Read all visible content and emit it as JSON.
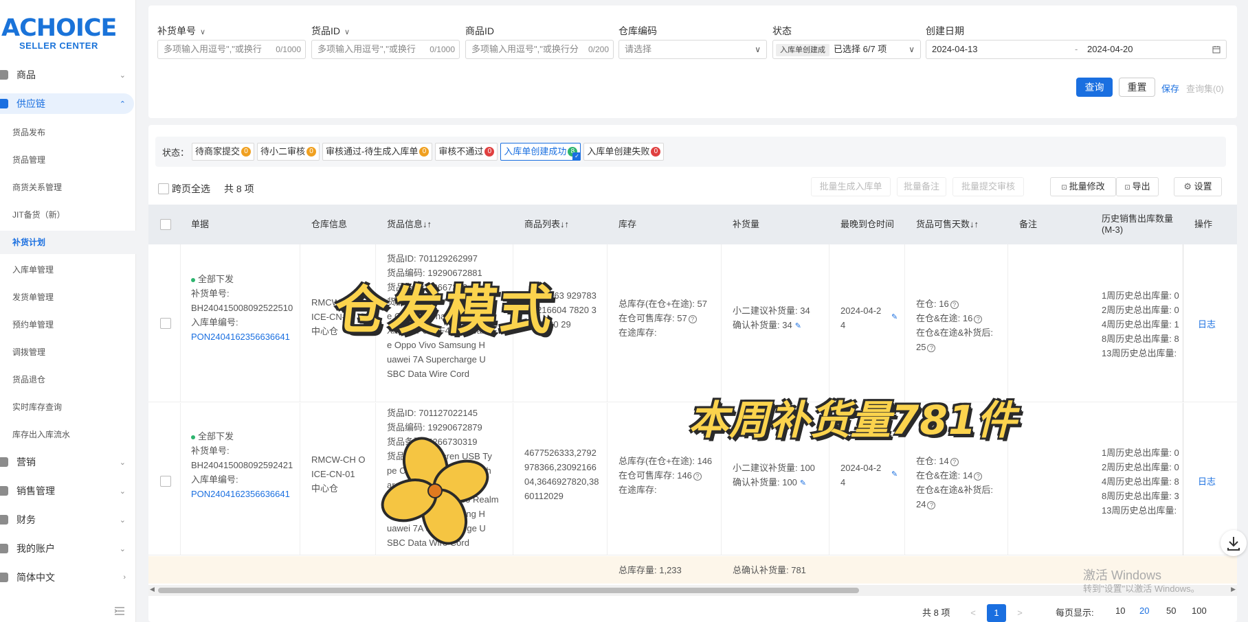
{
  "logo": {
    "brand": "ACHOICE",
    "sub": "SELLER CENTER"
  },
  "sidebar": {
    "top_items": [
      {
        "label": "商品"
      },
      {
        "label": "供应链"
      }
    ],
    "sub_items": [
      {
        "label": "货品发布"
      },
      {
        "label": "货品管理"
      },
      {
        "label": "商货关系管理"
      },
      {
        "label": "JIT备货（新）"
      },
      {
        "label": "补货计划"
      },
      {
        "label": "入库单管理"
      },
      {
        "label": "发货单管理"
      },
      {
        "label": "预约单管理"
      },
      {
        "label": "调拨管理"
      },
      {
        "label": "货品退仓"
      },
      {
        "label": "实时库存查询"
      },
      {
        "label": "库存出入库流水"
      }
    ],
    "bottom_items": [
      {
        "label": "营销"
      },
      {
        "label": "销售管理"
      },
      {
        "label": "财务"
      },
      {
        "label": "我的账户"
      },
      {
        "label": "简体中文"
      }
    ]
  },
  "filters": {
    "replenish_no": {
      "label": "补货单号",
      "placeholder": "多项输入用逗号\",\"或换行",
      "count": "0/1000"
    },
    "goods_id": {
      "label": "货品ID",
      "placeholder": "多项输入用逗号\",\"或换行",
      "count": "0/1000"
    },
    "product_id": {
      "label": "商品ID",
      "placeholder": "多项输入用逗号\",\"或换行分",
      "count": "0/200"
    },
    "warehouse_code": {
      "label": "仓库编码",
      "placeholder": "请选择"
    },
    "status": {
      "label": "状态",
      "chip": "入库单创建成",
      "summary": "已选择 6/7 项"
    },
    "create_date": {
      "label": "创建日期",
      "start": "2024-04-13",
      "sep": "-",
      "end": "2024-04-20"
    },
    "query_label": "查询",
    "reset_label": "重置",
    "save_label": "保存",
    "query_set_label": "查询集(0)"
  },
  "status_bar": {
    "label": "状态：",
    "items": [
      {
        "label": "待商家提交",
        "count": "0",
        "color": "#f0a020"
      },
      {
        "label": "待小二审核",
        "count": "0",
        "color": "#f0a020"
      },
      {
        "label": "审核通过-待生成入库单",
        "count": "0",
        "color": "#f0a020"
      },
      {
        "label": "审核不通过",
        "count": "0",
        "color": "#e04040"
      },
      {
        "label": "入库单创建成功",
        "count": "8",
        "color": "#2db46e"
      },
      {
        "label": "入库单创建失败",
        "count": "0",
        "color": "#e04040"
      }
    ]
  },
  "toolbar": {
    "select_all_label": "跨页全选",
    "total_label": "共 8 项",
    "batch_create_label": "批量生成入库单",
    "batch_note_label": "批量备注",
    "batch_submit_label": "批量提交审核",
    "batch_edit_label": "批量修改",
    "export_label": "导出",
    "settings_label": "设置"
  },
  "table": {
    "headers": [
      "单据",
      "仓库信息",
      "货品信息↓↑",
      "商品列表↓↑",
      "库存",
      "补货量",
      "最晚到仓时间",
      "货品可售天数↓↑",
      "备注",
      "历史销售出库数量(M-3)",
      "操作"
    ],
    "rows": [
      {
        "status": "全部下发",
        "replenish_no_label": "补货单号:",
        "replenish_no": "BH240415008092522510",
        "inbound_no_label": "入库单编号:",
        "inbound_no": "PON2404162356636641",
        "warehouse_code": "RMCW-CH OICE-CN-01",
        "warehouse_name": "中心仓",
        "goods_lines": [
          "货品ID: 701129262997",
          "货品编码: 19290672881",
          "货品条码: 52667303",
          "货品名称: 50W Fast",
          "e C Cable Charger Cable",
          "Xiaomi Poco F4 F3 Realm",
          "e Oppo Vivo Samsung H",
          "uawei 7A Supercharge U",
          "SBC Data Wire Cord"
        ],
        "product_list": "46775263 92978366 216604 7820 38601120 29",
        "stock_total": "总库存(在仓+在途): 57",
        "stock_sellable": "在仓可售库存: 57",
        "stock_transit": "在途库存:",
        "suggest": "小二建议补货量: 34",
        "confirm": "确认补货量: 34",
        "deadline": "2024-04-24",
        "days_in": "在仓: 16",
        "days_both": "在仓&在途: 16",
        "days_after": "在仓&在途&补货后: 25",
        "history": [
          "1周历史总出库量: 0",
          "2周历史总出库量: 0",
          "4周历史总出库量: 1",
          "8周历史总出库量: 8",
          "13周历史总出库量:"
        ],
        "action": "日志"
      },
      {
        "status": "全部下发",
        "replenish_no_label": "补货单号:",
        "replenish_no": "BH240415008092592421",
        "inbound_no_label": "入库单编号:",
        "inbound_no": "PON2404162356636641",
        "warehouse_code": "RMCW-CH OICE-CN-01",
        "warehouse_name": "中心仓",
        "goods_lines": [
          "货品ID: 701127022145",
          "货品编码: 19290672879",
          "货品条码: 5266730319",
          "货品名称: Toocren USB Ty",
          "pe C Cable 120W Fast Ch",
          "arger Cable For",
          "Xiaomi Realme Poco Realm",
          "e Oppo Vivo Samsung H",
          "uawei 7A Supercharge U",
          "SBC Data Wire Cord"
        ],
        "product_list": "4677526333,2792978366,2309216604,3646927820,3860112029",
        "stock_total": "总库存(在仓+在途): 146",
        "stock_sellable": "在仓可售库存: 146",
        "stock_transit": "在途库存:",
        "suggest": "小二建议补货量: 100",
        "confirm": "确认补货量: 100",
        "deadline": "2024-04-24",
        "days_in": "在仓: 14",
        "days_both": "在仓&在途: 14",
        "days_after": "在仓&在途&补货后: 24",
        "history": [
          "1周历史总出库量: 0",
          "2周历史总出库量: 0",
          "4周历史总出库量: 8",
          "8周历史总出库量: 3",
          "13周历史总出库量:"
        ],
        "action": "日志"
      }
    ],
    "summary_stock": "总库存量: 1,233",
    "summary_confirm": "总确认补货量: 781"
  },
  "pager": {
    "total": "共 8 项",
    "current": "1",
    "prev": "<",
    "next": ">",
    "page_size_label": "每页显示:",
    "sizes": [
      "10",
      "20",
      "50",
      "100"
    ]
  },
  "overlay": {
    "title": "仓发模式",
    "subtitle": "本周补货量781件"
  },
  "watermark": {
    "line1": "激活 Windows",
    "line2": "转到\"设置\"以激活 Windows。"
  },
  "colors": {
    "accent": "#1a6fe0",
    "overlay_yellow": "#fbd34d",
    "summary_bg": "#fdf6ea"
  }
}
